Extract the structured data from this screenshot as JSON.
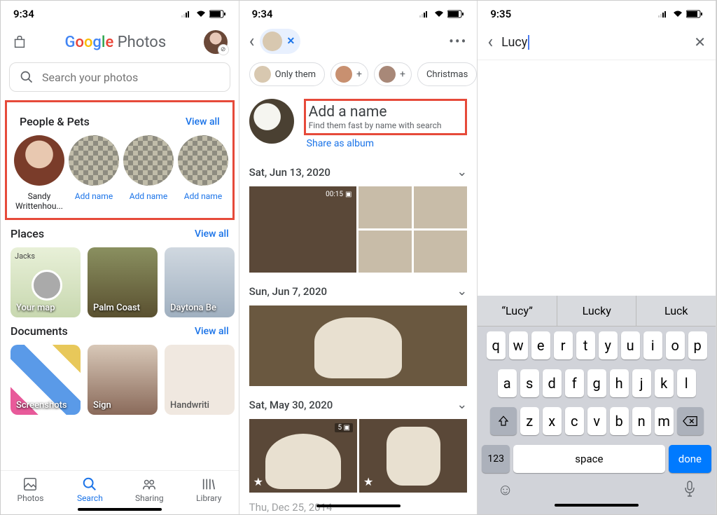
{
  "screen1": {
    "time": "9:34",
    "logo_photos": "Photos",
    "search_placeholder": "Search your photos",
    "people_pets": {
      "title": "People & Pets",
      "view_all": "View all",
      "items": [
        {
          "label": "Sandy Writtenhou..."
        },
        {
          "label": "Add name"
        },
        {
          "label": "Add name"
        },
        {
          "label": "Add name"
        }
      ]
    },
    "places": {
      "title": "Places",
      "view_all": "View all",
      "items": [
        {
          "label": "Your map",
          "corner": "Jacks"
        },
        {
          "label": "Palm Coast"
        },
        {
          "label": "Daytona Be"
        }
      ]
    },
    "documents": {
      "title": "Documents",
      "view_all": "View all",
      "items": [
        {
          "label": "Screenshots"
        },
        {
          "label": "Sign"
        },
        {
          "label": "Handwriti"
        }
      ]
    },
    "tabs": [
      {
        "label": "Photos"
      },
      {
        "label": "Search"
      },
      {
        "label": "Sharing"
      },
      {
        "label": "Library"
      }
    ]
  },
  "screen2": {
    "time": "9:34",
    "chips": [
      {
        "label": "Only them",
        "hasImg": true
      },
      {
        "label": "+",
        "hasImg": true,
        "plus": true
      },
      {
        "label": "+",
        "hasImg": true,
        "plus": true
      },
      {
        "label": "Christmas"
      }
    ],
    "add_name": "Add a name",
    "add_sub": "Find them fast by name with search",
    "share": "Share as album",
    "dates": [
      {
        "label": "Sat, Jun 13, 2020",
        "vid": "00:15"
      },
      {
        "label": "Sun, Jun 7, 2020"
      },
      {
        "label": "Sat, May 30, 2020",
        "multi": "5"
      },
      {
        "label": "Thu, Dec 25, 2014"
      }
    ]
  },
  "screen3": {
    "time": "9:35",
    "input_value": "Lucy",
    "suggestions": [
      "“Lucy”",
      "Lucky",
      "Luck"
    ],
    "rows": [
      [
        "q",
        "w",
        "e",
        "r",
        "t",
        "y",
        "u",
        "i",
        "o",
        "p"
      ],
      [
        "a",
        "s",
        "d",
        "f",
        "g",
        "h",
        "j",
        "k",
        "l"
      ],
      [
        "z",
        "x",
        "c",
        "v",
        "b",
        "n",
        "m"
      ]
    ],
    "num_key": "123",
    "space": "space",
    "done": "done"
  }
}
